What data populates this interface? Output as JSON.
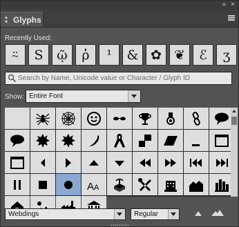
{
  "window": {
    "collapse_icon": "double-chevron-right-icon",
    "close_icon": "close-icon"
  },
  "tab": {
    "title": "Glyphs",
    "icon": "expand-collapse-arrows-icon"
  },
  "panel_menu_icon": "hamburger-menu-icon",
  "recent": {
    "label": "Recently Used:",
    "glyphs": [
      "⍨",
      "S",
      "ῷ",
      "ῤ",
      "¹",
      "&",
      "✿",
      "❦",
      "ℰ",
      "ʒ"
    ]
  },
  "search": {
    "placeholder": "Search by Name, Unicode value or Character / Glyph ID",
    "value": ""
  },
  "show": {
    "label": "Show:",
    "value": "Entire Font"
  },
  "grid": {
    "selected_index": 29,
    "cells": [
      {
        "icon": "blank-icon"
      },
      {
        "icon": "spider-icon"
      },
      {
        "icon": "spider-web-icon"
      },
      {
        "icon": "face-icon"
      },
      {
        "icon": "sunglasses-icon"
      },
      {
        "icon": "trophy-icon"
      },
      {
        "icon": "medal-icon"
      },
      {
        "icon": "chain-link-icon"
      },
      {
        "icon": "speech-bubble-icon"
      },
      {
        "icon": "speech-bubble-icon"
      },
      {
        "icon": "explosion-icon"
      },
      {
        "icon": "explosion-icon"
      },
      {
        "icon": "chili-pepper-icon"
      },
      {
        "icon": "ribbon-icon"
      },
      {
        "icon": "stacked-squares-icon"
      },
      {
        "icon": "parallelogram-icon"
      },
      {
        "icon": "underscore-icon"
      },
      {
        "icon": "window-icon"
      },
      {
        "icon": "window-icon"
      },
      {
        "icon": "triangle-left-icon"
      },
      {
        "icon": "triangle-right-icon"
      },
      {
        "icon": "triangle-up-icon"
      },
      {
        "icon": "triangle-down-icon"
      },
      {
        "icon": "rewind-icon"
      },
      {
        "icon": "fast-forward-icon"
      },
      {
        "icon": "skip-back-icon"
      },
      {
        "icon": "skip-forward-icon"
      },
      {
        "icon": "pause-icon"
      },
      {
        "icon": "stop-icon"
      },
      {
        "icon": "record-icon"
      },
      {
        "icon": "text-size-icon"
      },
      {
        "icon": "island-icon"
      },
      {
        "icon": "tools-icon"
      },
      {
        "icon": "building-icon"
      },
      {
        "icon": "houses-icon"
      },
      {
        "icon": "city-icon"
      },
      {
        "icon": "house-icon"
      },
      {
        "icon": "landscape-icon"
      },
      {
        "icon": "factory-icon"
      },
      {
        "icon": "bank-icon"
      }
    ]
  },
  "bottom": {
    "font": "Webdings",
    "style": "Regular",
    "zoom_out_icon": "small-mountain-icon",
    "zoom_in_icon": "large-mountain-icon"
  }
}
